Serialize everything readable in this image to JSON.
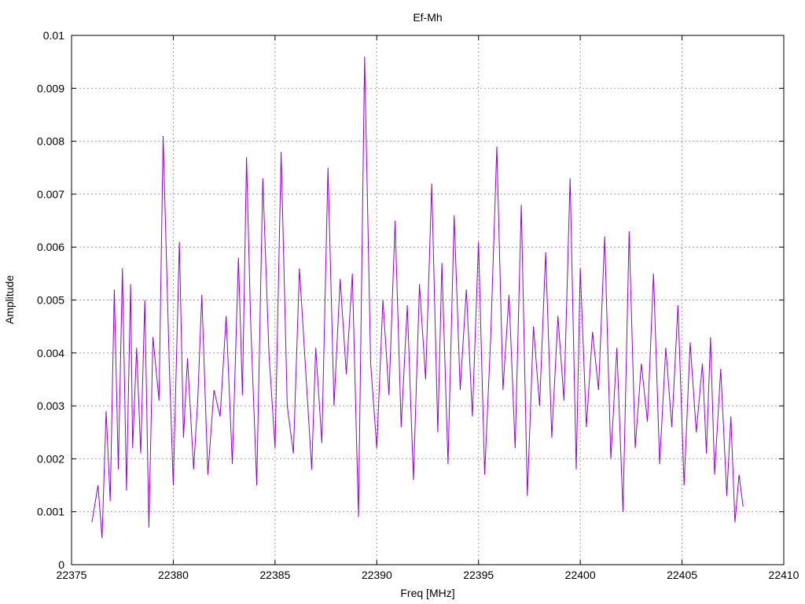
{
  "chart_data": {
    "type": "line",
    "title": "Ef-Mh",
    "xlabel": "Freq [MHz]",
    "ylabel": "Amplitude",
    "xlim": [
      22375,
      22410
    ],
    "ylim": [
      0,
      0.01
    ],
    "xticks": [
      22375,
      22380,
      22385,
      22390,
      22395,
      22400,
      22405,
      22410
    ],
    "xtick_labels": [
      "22375",
      "22380",
      "22385",
      "22390",
      "22395",
      "22400",
      "22405",
      "22410"
    ],
    "yticks": [
      0,
      0.001,
      0.002,
      0.003,
      0.004,
      0.005,
      0.006,
      0.007,
      0.008,
      0.009,
      0.01
    ],
    "ytick_labels": [
      "0",
      "0.001",
      "0.002",
      "0.003",
      "0.004",
      "0.005",
      "0.006",
      "0.007",
      "0.008",
      "0.009",
      "0.01"
    ],
    "grid": true,
    "legend": "none",
    "series": [
      {
        "color": "#9400d3",
        "x": [
          22376.0,
          22376.3,
          22376.5,
          22376.7,
          22376.9,
          22377.1,
          22377.3,
          22377.5,
          22377.7,
          22377.9,
          22378.0,
          22378.2,
          22378.4,
          22378.6,
          22378.8,
          22379.0,
          22379.3,
          22379.5,
          22379.8,
          22380.0,
          22380.3,
          22380.5,
          22380.7,
          22381.0,
          22381.2,
          22381.4,
          22381.7,
          22382.0,
          22382.3,
          22382.6,
          22382.9,
          22383.2,
          22383.4,
          22383.6,
          22383.8,
          22384.1,
          22384.4,
          22384.7,
          22385.0,
          22385.3,
          22385.6,
          22385.9,
          22386.2,
          22386.5,
          22386.8,
          22387.0,
          22387.3,
          22387.6,
          22387.9,
          22388.2,
          22388.5,
          22388.8,
          22389.1,
          22389.4,
          22389.7,
          22390.0,
          22390.3,
          22390.6,
          22390.9,
          22391.2,
          22391.5,
          22391.8,
          22392.1,
          22392.4,
          22392.7,
          22393.0,
          22393.2,
          22393.5,
          22393.8,
          22394.1,
          22394.4,
          22394.7,
          22395.0,
          22395.3,
          22395.6,
          22395.9,
          22396.2,
          22396.5,
          22396.8,
          22397.1,
          22397.4,
          22397.7,
          22398.0,
          22398.3,
          22398.6,
          22398.9,
          22399.2,
          22399.5,
          22399.8,
          22400.0,
          22400.3,
          22400.6,
          22400.9,
          22401.2,
          22401.5,
          22401.8,
          22402.1,
          22402.4,
          22402.7,
          22403.0,
          22403.3,
          22403.6,
          22403.9,
          22404.2,
          22404.5,
          22404.8,
          22405.1,
          22405.4,
          22405.7,
          22406.0,
          22406.2,
          22406.4,
          22406.6,
          22406.9,
          22407.2,
          22407.4,
          22407.6,
          22407.8,
          22408.0
        ],
        "y": [
          0.0008,
          0.0015,
          0.0005,
          0.0029,
          0.0012,
          0.0052,
          0.0018,
          0.0056,
          0.0014,
          0.0053,
          0.0022,
          0.0041,
          0.0021,
          0.005,
          0.0007,
          0.0043,
          0.0031,
          0.0081,
          0.0038,
          0.0015,
          0.0061,
          0.0024,
          0.0039,
          0.0018,
          0.0031,
          0.0051,
          0.0017,
          0.0033,
          0.0028,
          0.0047,
          0.0019,
          0.0058,
          0.0032,
          0.0077,
          0.0046,
          0.0015,
          0.0073,
          0.004,
          0.0022,
          0.0078,
          0.003,
          0.0021,
          0.0056,
          0.0037,
          0.0018,
          0.0041,
          0.0023,
          0.0075,
          0.003,
          0.0054,
          0.0036,
          0.0055,
          0.0009,
          0.0096,
          0.0038,
          0.0022,
          0.005,
          0.0032,
          0.0065,
          0.0026,
          0.0049,
          0.0016,
          0.0053,
          0.0035,
          0.0072,
          0.0025,
          0.0057,
          0.0019,
          0.0066,
          0.0033,
          0.0052,
          0.0028,
          0.0061,
          0.0017,
          0.0043,
          0.0079,
          0.0033,
          0.0051,
          0.0022,
          0.0068,
          0.0013,
          0.0045,
          0.003,
          0.0059,
          0.0024,
          0.0047,
          0.0031,
          0.0073,
          0.0018,
          0.0056,
          0.0026,
          0.0044,
          0.0033,
          0.0062,
          0.002,
          0.0041,
          0.001,
          0.0063,
          0.0022,
          0.0038,
          0.0027,
          0.0055,
          0.0019,
          0.0041,
          0.0026,
          0.0049,
          0.0015,
          0.0042,
          0.0025,
          0.0038,
          0.0021,
          0.0043,
          0.0017,
          0.0037,
          0.0013,
          0.0028,
          0.0008,
          0.0017,
          0.0011
        ]
      }
    ]
  }
}
